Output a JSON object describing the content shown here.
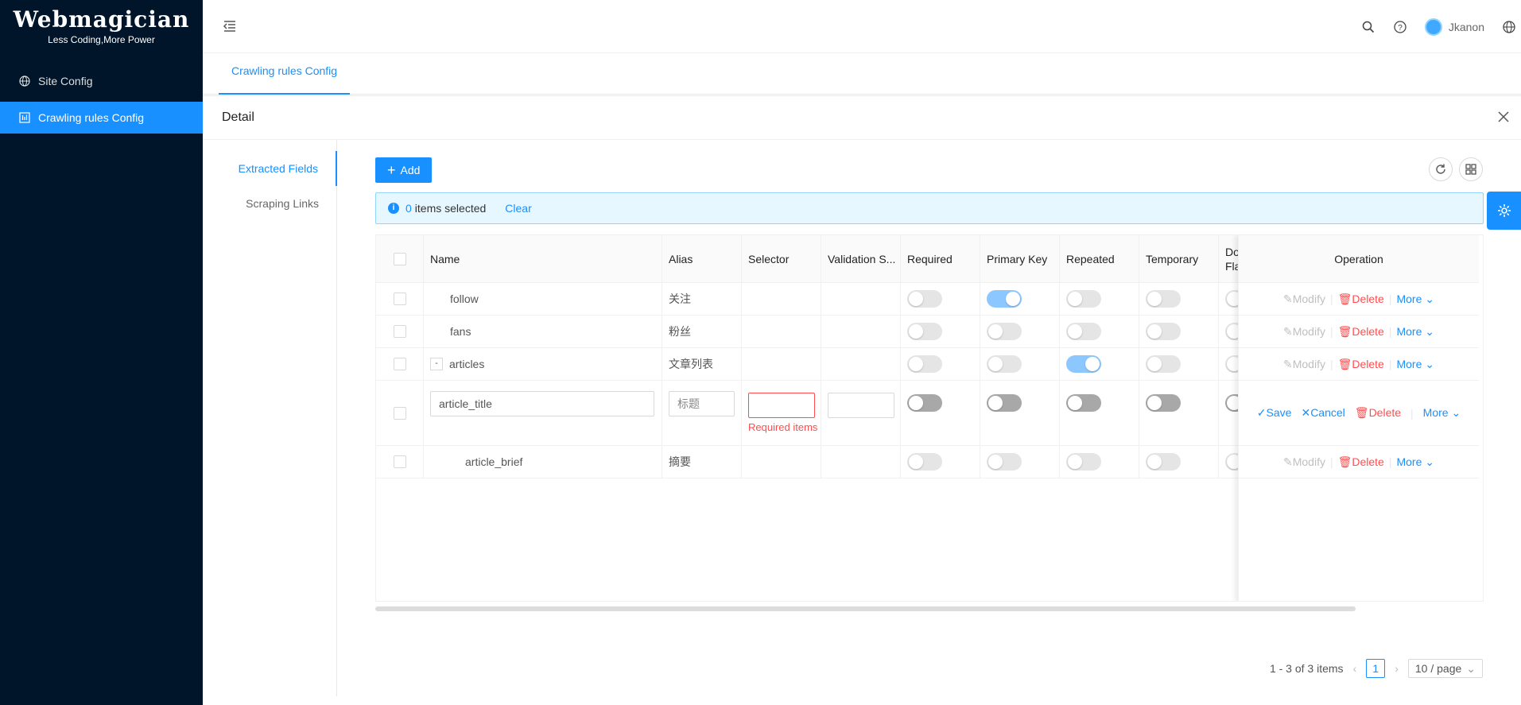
{
  "logo": {
    "title": "Webmagician",
    "subtitle": "Less Coding,More Power"
  },
  "sidebar": {
    "items": [
      {
        "label": "Site Config",
        "icon": "globe-icon",
        "active": false
      },
      {
        "label": "Crawling rules Config",
        "icon": "dashboard-icon",
        "active": true
      }
    ]
  },
  "header": {
    "username": "Jkanon",
    "icons": [
      "search-icon",
      "question-icon",
      "avatar",
      "globe-icon"
    ]
  },
  "tabs": [
    {
      "label": "Crawling rules Config",
      "active": true
    }
  ],
  "detail": {
    "title": "Detail",
    "vtabs": [
      {
        "label": "Extracted Fields",
        "active": true
      },
      {
        "label": "Scraping Links",
        "active": false
      }
    ],
    "add_label": "Add",
    "alert": {
      "count": "0",
      "text": "items selected",
      "clear": "Clear"
    }
  },
  "table": {
    "columns": [
      "Name",
      "Alias",
      "Selector",
      "Validation S...",
      "Required",
      "Primary Key",
      "Repeated",
      "Temporary",
      "Do Fla",
      "Operation"
    ],
    "rows": [
      {
        "name": "follow",
        "alias": "关注",
        "indent": 1,
        "required": false,
        "primary": true,
        "repeated": false,
        "temporary": false
      },
      {
        "name": "fans",
        "alias": "粉丝",
        "indent": 1,
        "required": false,
        "primary": false,
        "repeated": false,
        "temporary": false
      },
      {
        "name": "articles",
        "alias": "文章列表",
        "indent": 0,
        "toggle": "-",
        "required": false,
        "primary": false,
        "repeated": true,
        "temporary": false
      },
      {
        "name": "article_title",
        "alias": "标题",
        "editing": true,
        "error": "Required items",
        "required": false,
        "primary": false,
        "repeated": false,
        "temporary": false
      },
      {
        "name": "article_brief",
        "alias": "摘要",
        "indent": 2,
        "required": false,
        "primary": false,
        "repeated": false,
        "temporary": false
      }
    ],
    "ops": {
      "modify": "Modify",
      "delete": "Delete",
      "more": "More",
      "save": "Save",
      "cancel": "Cancel"
    }
  },
  "pagination": {
    "summary": "1 - 3 of 3 items",
    "current": "1",
    "page_size": "10 / page"
  }
}
